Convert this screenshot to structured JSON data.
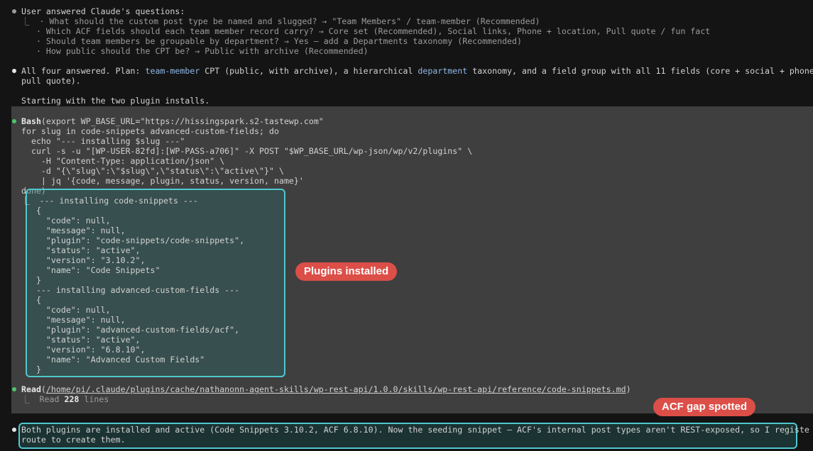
{
  "qa": {
    "header": "User answered Claude's questions:",
    "items": [
      "⎿  · What should the custom post type be named and slugged? → \"Team Members\" / team-member (Recommended)",
      "   · Which ACF fields should each team member record carry? → Core set (Recommended), Social links, Phone + location, Pull quote / fun fact",
      "   · Should team members be groupable by department? → Yes — add a Departments taxonomy (Recommended)",
      "   · How public should the CPT be? → Public with archive (Recommended)"
    ]
  },
  "plan": {
    "p1": "All four answered. Plan: ",
    "cpt": "team-member",
    "p2": " CPT (public, with archive), a hierarchical ",
    "tax": "department",
    "p3": " taxonomy, and a field group with all 11 fields (core + social + phone",
    "line2": "pull quote).",
    "line3": "Starting with the two plugin installs."
  },
  "bash": {
    "tool": "Bash",
    "command": [
      "(export WP_BASE_URL=\"https://hissingspark.s2-tastewp.com\"",
      "for slug in code-snippets advanced-custom-fields; do",
      "  echo \"--- installing $slug ---\"",
      "  curl -s -u \"[WP-USER-82fd]:[WP-PASS-a706]\" -X POST \"$WP_BASE_URL/wp-json/wp/v2/plugins\" \\",
      "    -H \"Content-Type: application/json\" \\",
      "    -d \"{\\\"slug\\\":\\\"$slug\\\",\\\"status\\\":\\\"active\\\"}\" \\",
      "    | jq '{code, message, plugin, status, version, name}'",
      "done)"
    ],
    "output": [
      "⎿  --- installing code-snippets ---",
      "   {",
      "     \"code\": null,",
      "     \"message\": null,",
      "     \"plugin\": \"code-snippets/code-snippets\",",
      "     \"status\": \"active\",",
      "     \"version\": \"3.10.2\",",
      "     \"name\": \"Code Snippets\"",
      "   }",
      "   --- installing advanced-custom-fields ---",
      "   {",
      "     \"code\": null,",
      "     \"message\": null,",
      "     \"plugin\": \"advanced-custom-fields/acf\",",
      "     \"status\": \"active\",",
      "     \"version\": \"6.8.10\",",
      "     \"name\": \"Advanced Custom Fields\"",
      "   }"
    ]
  },
  "read": {
    "tool": "Read",
    "path": "/home/pi/.claude/plugins/cache/nathanonn-agent-skills/wp-rest-api/1.0.0/skills/wp-rest-api/reference/code-snippets.md",
    "result_prefix": "⎿  Read ",
    "count": "228",
    "result_suffix": " lines"
  },
  "final": {
    "line1": "Both plugins are installed and active (Code Snippets 3.10.2, ACF 6.8.10). Now the seeding snippet — ACF's internal post types aren't REST-exposed, so I registe",
    "line2": "route to create them."
  },
  "annotations": {
    "plugins_installed": "Plugins installed",
    "acf_gap": "ACF gap spotted"
  }
}
